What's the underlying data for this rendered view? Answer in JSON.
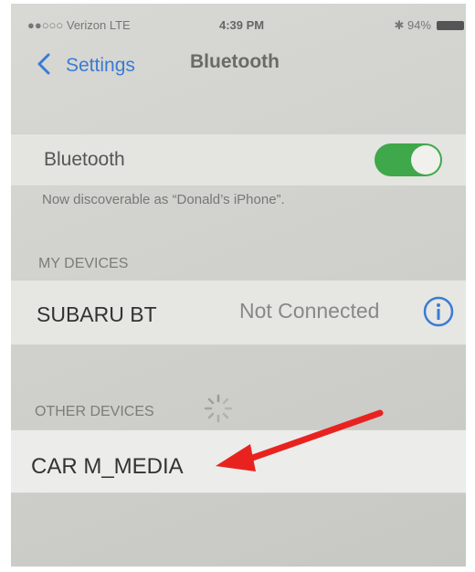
{
  "status_bar": {
    "carrier": "●●○○○ Verizon  LTE",
    "time": "4:39 PM",
    "battery": "✱ 94%"
  },
  "nav": {
    "back_label": "Settings",
    "title": "Bluetooth"
  },
  "bluetooth": {
    "label": "Bluetooth",
    "enabled": true,
    "discoverable_note": "Now discoverable as “Donald’s iPhone”."
  },
  "my_devices": {
    "header": "MY DEVICES",
    "items": [
      {
        "name": "SUBARU BT",
        "status": "Not Connected"
      }
    ]
  },
  "other_devices": {
    "header": "OTHER DEVICES",
    "items": [
      {
        "name": "CAR M_MEDIA"
      }
    ]
  },
  "colors": {
    "accent": "#3a7bd5",
    "toggle_on": "#3fa84a",
    "arrow": "#e8231f"
  },
  "icons": [
    "back-chevron-icon",
    "info-icon",
    "loading-spinner-icon",
    "red-arrow-annotation"
  ]
}
